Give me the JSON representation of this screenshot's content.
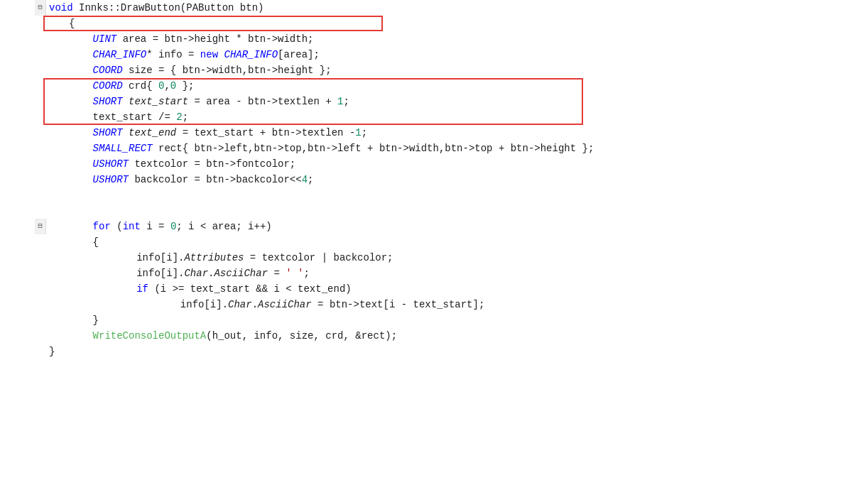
{
  "editor": {
    "language": "cpp",
    "theme": "light",
    "lines": [
      {
        "num": "",
        "fold": "⊟",
        "indent": 0,
        "content": "void Innks::DrawButton(PAButton btn)"
      },
      {
        "num": "",
        "fold": "",
        "indent": 1,
        "content": "{"
      },
      {
        "num": "",
        "fold": "",
        "indent": 1,
        "content": "    UINT area = btn->height * btn->width;",
        "redbox": 1
      },
      {
        "num": "",
        "fold": "",
        "indent": 1,
        "content": "    CHAR_INFO* info = new CHAR_INFO[area];"
      },
      {
        "num": "",
        "fold": "",
        "indent": 1,
        "content": "    COORD size = { btn->width,btn->height };"
      },
      {
        "num": "",
        "fold": "",
        "indent": 1,
        "content": "    COORD crd{ 0,0 };"
      },
      {
        "num": "",
        "fold": "",
        "indent": 1,
        "content": "    SHORT text_start = area - btn->textlen + 1;",
        "redbox": 2
      },
      {
        "num": "",
        "fold": "",
        "indent": 1,
        "content": "    text_start /= 2;",
        "redbox": 2
      },
      {
        "num": "",
        "fold": "",
        "indent": 1,
        "content": "    SHORT text_end = text_start + btn->textlen -1;",
        "redbox": 2
      },
      {
        "num": "",
        "fold": "",
        "indent": 1,
        "content": "    SMALL_RECT rect{ btn->left,btn->top,btn->left + btn->width,btn->top + btn->height };"
      },
      {
        "num": "",
        "fold": "",
        "indent": 1,
        "content": "    USHORT textcolor = btn->fontcolor;"
      },
      {
        "num": "",
        "fold": "",
        "indent": 1,
        "content": "    USHORT backcolor = btn->backcolor<<4;"
      },
      {
        "num": "",
        "fold": "",
        "indent": 1,
        "content": ""
      },
      {
        "num": "",
        "fold": "",
        "indent": 1,
        "content": ""
      },
      {
        "num": "",
        "fold": "⊟",
        "indent": 1,
        "content": "    for (int i = 0; i < area; i++)"
      },
      {
        "num": "",
        "fold": "",
        "indent": 1,
        "content": "    {"
      },
      {
        "num": "",
        "fold": "",
        "indent": 2,
        "content": "        info[i].Attributes = textcolor | backcolor;"
      },
      {
        "num": "",
        "fold": "",
        "indent": 2,
        "content": "        info[i].Char.AsciiChar = ' ';"
      },
      {
        "num": "",
        "fold": "",
        "indent": 2,
        "content": "        if (i >= text_start && i < text_end)"
      },
      {
        "num": "",
        "fold": "",
        "indent": 3,
        "content": "            info[i].Char.AsciiChar = btn->text[i - text_start];"
      },
      {
        "num": "",
        "fold": "",
        "indent": 2,
        "content": "    }"
      },
      {
        "num": "",
        "fold": "",
        "indent": 1,
        "content": "    WriteConsoleOutputA(h_out, info, size, crd, &rect);"
      },
      {
        "num": "",
        "fold": "",
        "indent": 1,
        "content": "}"
      }
    ]
  }
}
